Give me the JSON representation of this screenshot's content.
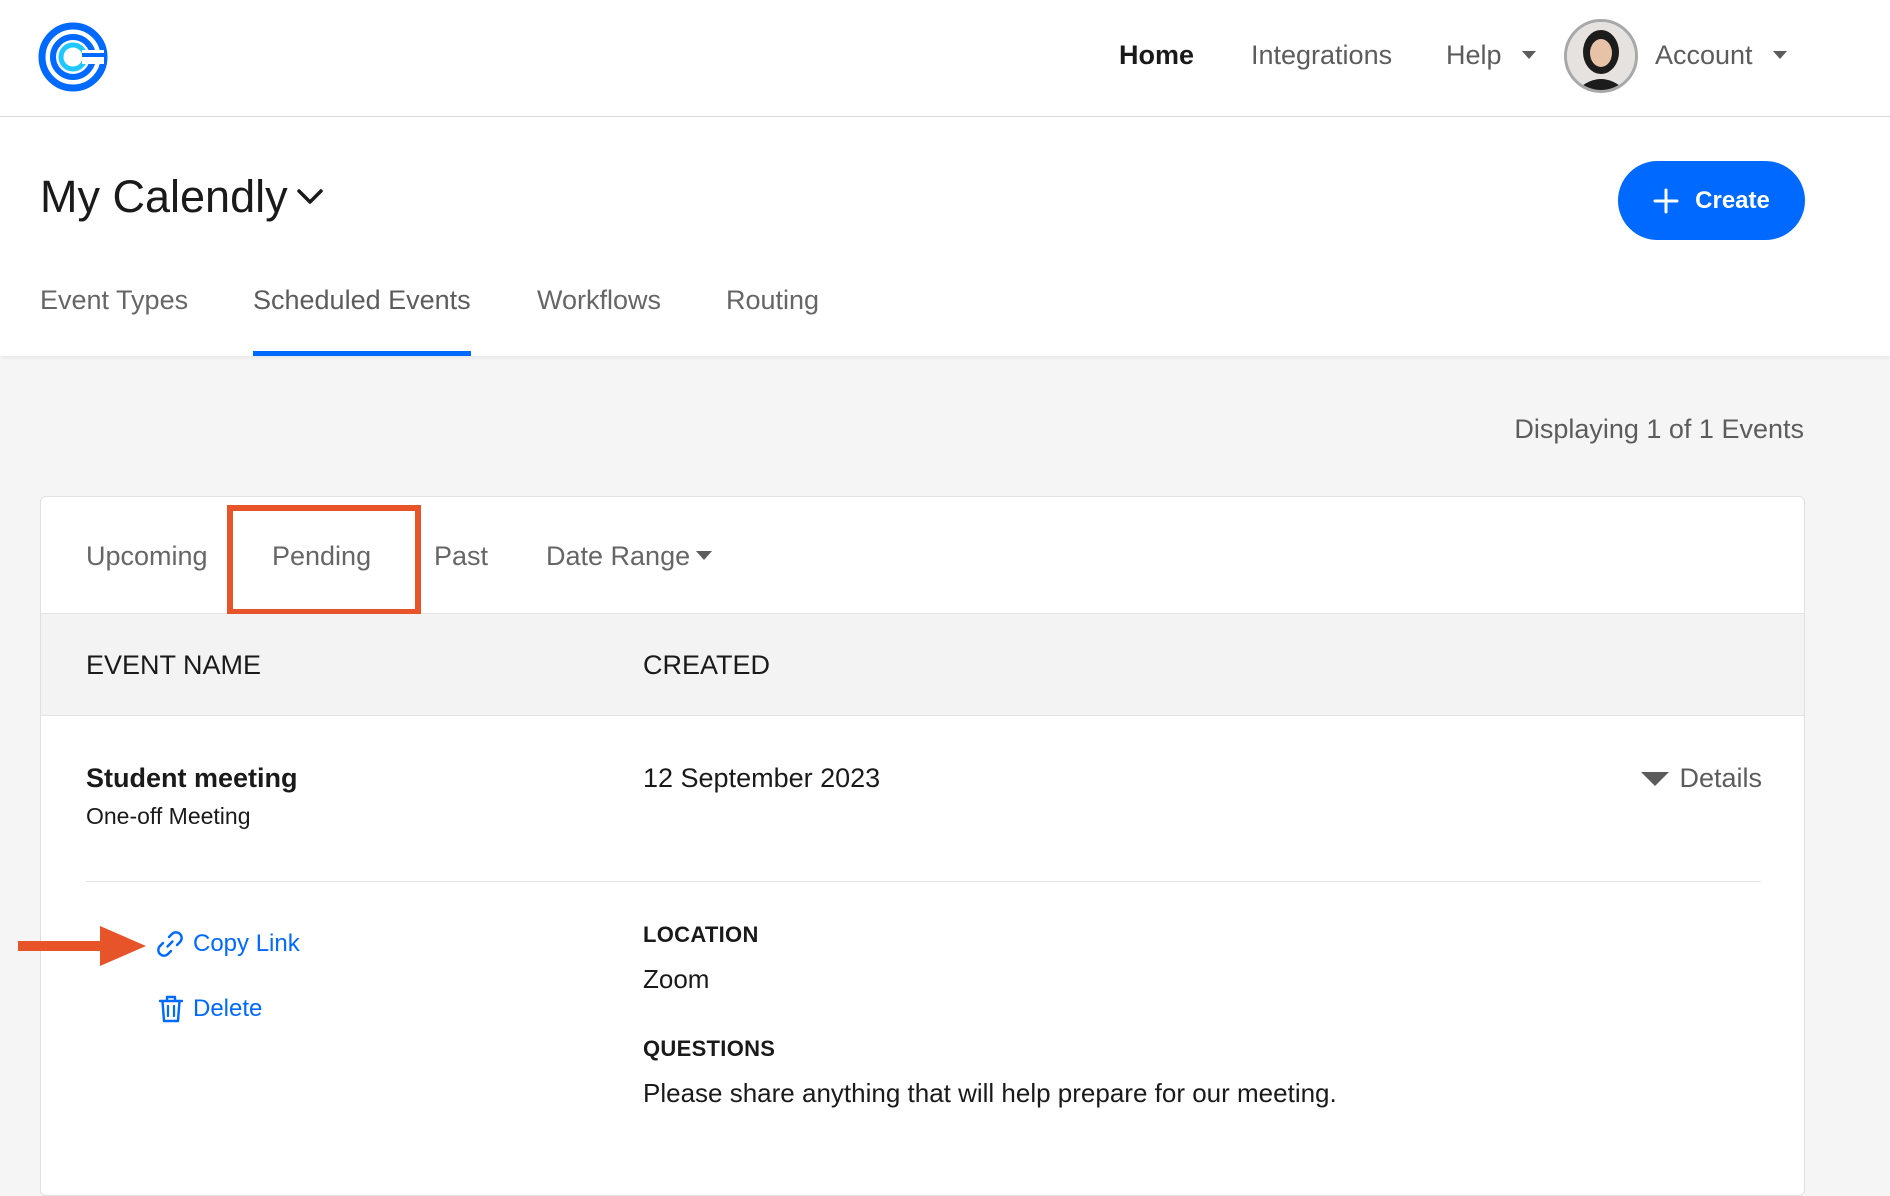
{
  "nav": {
    "home": "Home",
    "integrations": "Integrations",
    "help": "Help",
    "account": "Account"
  },
  "header": {
    "title": "My Calendly",
    "create_label": "Create",
    "tabs": [
      {
        "label": "Event Types"
      },
      {
        "label": "Scheduled Events"
      },
      {
        "label": "Workflows"
      },
      {
        "label": "Routing"
      }
    ]
  },
  "summary": "Displaying 1 of 1 Events",
  "filters": {
    "upcoming": "Upcoming",
    "pending": "Pending",
    "past": "Past",
    "date_range": "Date Range"
  },
  "table": {
    "columns": [
      "EVENT NAME",
      "CREATED"
    ],
    "event": {
      "name": "Student meeting",
      "type": "One-off Meeting",
      "created": "12 September 2023",
      "details_label": "Details",
      "actions": {
        "copy_link": "Copy Link",
        "delete": "Delete"
      },
      "location_label": "LOCATION",
      "location_value": "Zoom",
      "questions_label": "QUESTIONS",
      "questions_value": "Please share anything that will help prepare for our meeting."
    }
  },
  "colors": {
    "brand_blue": "#0069ff",
    "annotation_orange": "#e8542a"
  }
}
